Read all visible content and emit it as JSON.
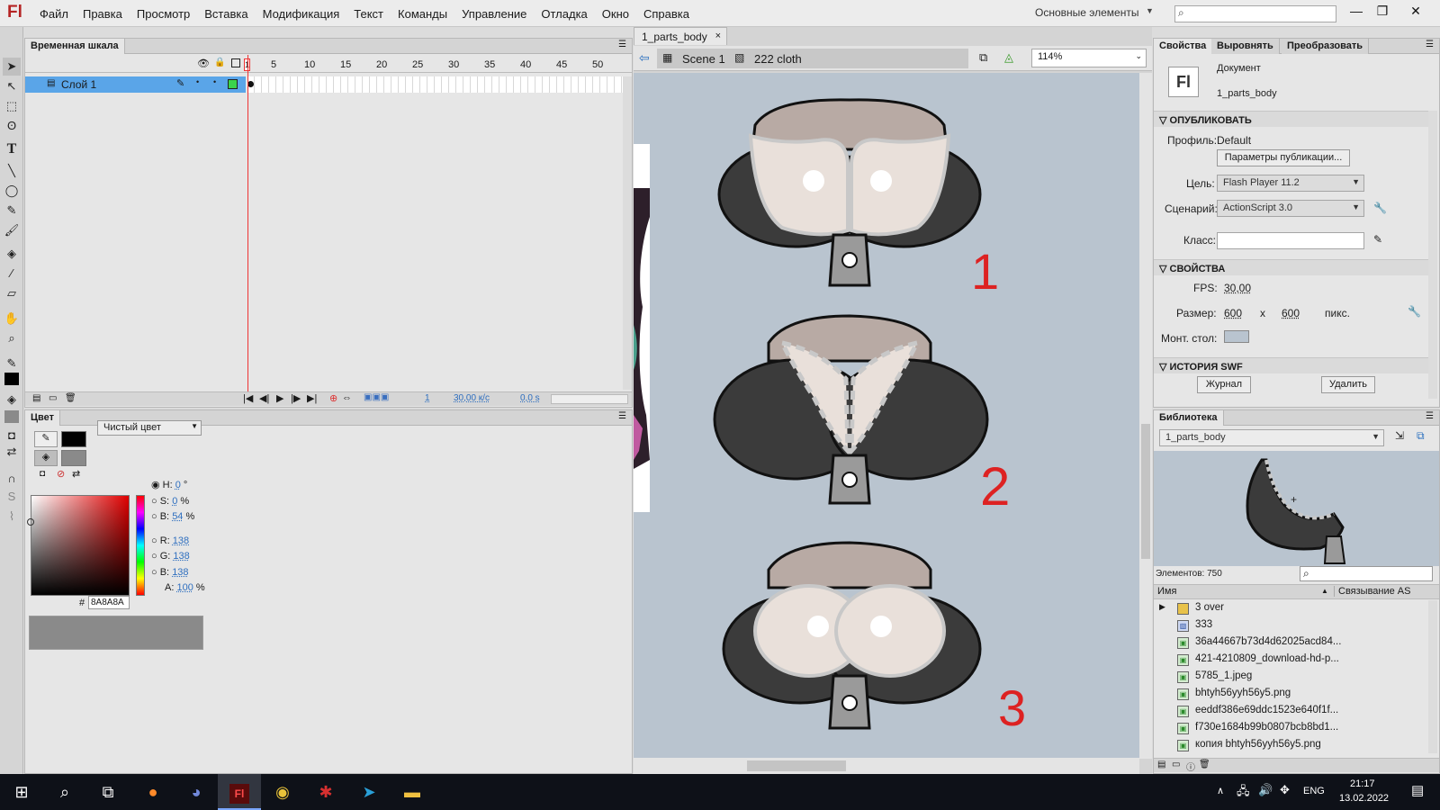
{
  "app": {
    "logo": "Fl"
  },
  "menu": [
    "Файл",
    "Правка",
    "Просмотр",
    "Вставка",
    "Модификация",
    "Текст",
    "Команды",
    "Управление",
    "Отладка",
    "Окно",
    "Справка"
  ],
  "workspace": "Основные элементы",
  "timeline": {
    "tab": "Временная шкала",
    "ruler": [
      "1",
      "5",
      "10",
      "15",
      "20",
      "25",
      "30",
      "35",
      "40",
      "45",
      "50"
    ],
    "layer": "Слой 1",
    "status": {
      "frame": "1",
      "fps": "30,00 к/с",
      "time": "0,0 s"
    }
  },
  "color_panel": {
    "tab": "Цвет",
    "type": "Чистый цвет",
    "h": "0",
    "h_unit": "°",
    "s": "0",
    "s_unit": "%",
    "b": "54",
    "b_unit": "%",
    "r": "138",
    "g": "138",
    "bl": "138",
    "a": "100",
    "a_unit": "%",
    "hex_label": "#",
    "hex": "8A8A8A",
    "labels": {
      "h": "H:",
      "s": "S:",
      "b": "B:",
      "r": "R:",
      "g": "G:",
      "bl": "B:",
      "a": "A:"
    },
    "swatch_color": "#8a8a8a"
  },
  "document": {
    "tab": "1_parts_body",
    "scene": "Scene 1",
    "symbol": "222 cloth",
    "zoom": "114%",
    "stage_color": "#b9c4cf",
    "drawing_labels": [
      "1",
      "2",
      "3"
    ]
  },
  "properties": {
    "tabs": [
      "Свойства",
      "Выровнять",
      "Преобразовать"
    ],
    "doc_icon": "Fl",
    "doc_type": "Документ",
    "doc_name": "1_parts_body",
    "publish_header": "ОПУБЛИКОВАТЬ",
    "profile_label": "Профиль:",
    "profile": "Default",
    "publish_settings": "Параметры публикации...",
    "target_label": "Цель:",
    "target": "Flash Player 11.2",
    "script_label": "Сценарий:",
    "script": "ActionScript 3.0",
    "class_label": "Класс:",
    "props_header": "СВОЙСТВА",
    "fps_label": "FPS:",
    "fps": "30,00",
    "size_label": "Размер:",
    "width": "600",
    "x": "x",
    "height": "600",
    "unit": "пикс.",
    "stage_label": "Монт. стол:",
    "swf_header": "ИСТОРИЯ SWF",
    "log_btn": "Журнал",
    "delete_btn": "Удалить"
  },
  "library": {
    "tab": "Библиотека",
    "doc": "1_parts_body",
    "count": "Элементов: 750",
    "col_name": "Имя",
    "col_link": "Связывание AS",
    "items": [
      "3 over",
      "333",
      "36a44667b73d4d62025acd84...",
      "421-4210809_download-hd-p...",
      "5785_1.jpeg",
      "bhtyh56yyh56y5.png",
      "eeddf386e69ddc1523e640f1f...",
      "f730e1684b99b0807bcb8bd1...",
      "копия bhtyh56yyh56y5.png"
    ]
  },
  "taskbar": {
    "lang": "ENG",
    "time": "21:17",
    "date": "13.02.2022"
  }
}
